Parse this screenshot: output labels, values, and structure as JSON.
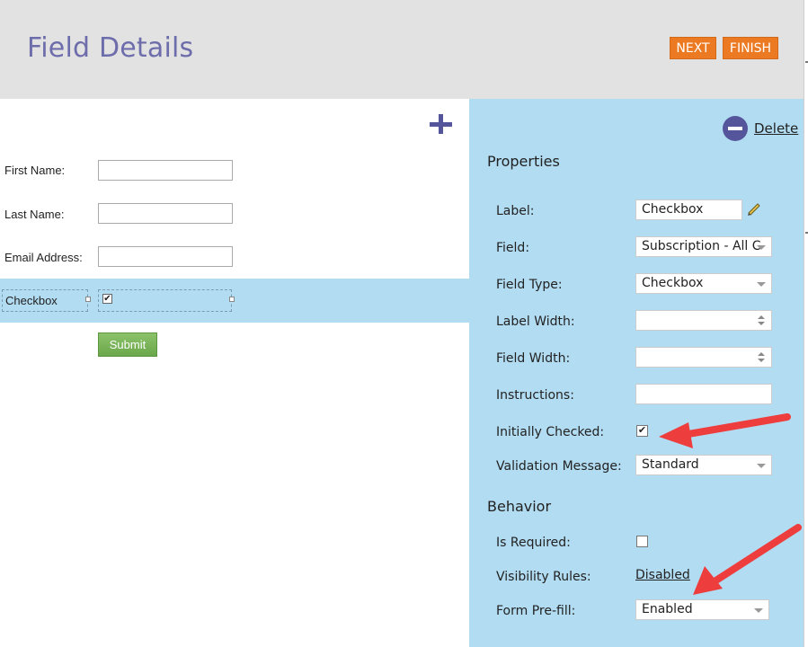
{
  "header": {
    "title": "Field Details",
    "next_label": "NEXT",
    "finish_label": "FINISH",
    "accent_color": "#ec7a22"
  },
  "form": {
    "fields": [
      {
        "label": "First Name:",
        "value": ""
      },
      {
        "label": "Last Name:",
        "value": ""
      },
      {
        "label": "Email Address:",
        "value": ""
      }
    ],
    "checkbox_label": "Checkbox",
    "checkbox_checked": true,
    "submit_label": "Submit",
    "add_icon": "plus-icon"
  },
  "properties": {
    "delete_label": "Delete",
    "delete_icon": "minus-circle-icon",
    "section_title": "Properties",
    "label": {
      "label": "Label:",
      "value": "Checkbox"
    },
    "field": {
      "label": "Field:",
      "value": "Subscription - All C"
    },
    "field_type": {
      "label": "Field Type:",
      "value": "Checkbox"
    },
    "label_width": {
      "label": "Label Width:",
      "value": ""
    },
    "field_width": {
      "label": "Field Width:",
      "value": ""
    },
    "instructions": {
      "label": "Instructions:",
      "value": ""
    },
    "initially_checked": {
      "label": "Initially Checked:",
      "checked": true
    },
    "validation_message": {
      "label": "Validation Message:",
      "value": "Standard"
    }
  },
  "behavior": {
    "section_title": "Behavior",
    "is_required": {
      "label": "Is Required:",
      "checked": false
    },
    "visibility_rules": {
      "label": "Visibility Rules:",
      "value": "Disabled"
    },
    "form_prefill": {
      "label": "Form Pre-fill:",
      "value": "Enabled"
    }
  },
  "annotations": {
    "arrow_color": "#ee3d3d"
  }
}
